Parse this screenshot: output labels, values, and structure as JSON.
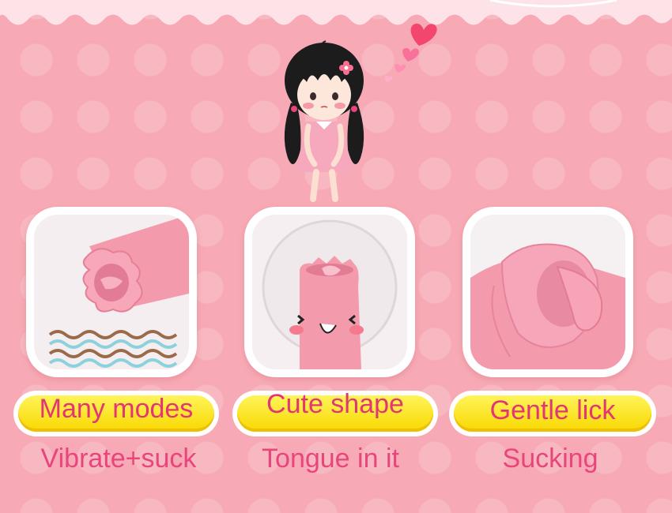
{
  "features": [
    {
      "label": "Many modes",
      "caption": "Vibrate+suck"
    },
    {
      "label": "Cute shape",
      "caption": "Tongue in it"
    },
    {
      "label": "Gentle lick",
      "caption": "Sucking"
    }
  ],
  "colors": {
    "background": "#f7aab5",
    "label_text": "#e23575",
    "caption_text": "#e8467b",
    "pill_yellow": "#fff45a",
    "product_pink": "#f49aad"
  },
  "icons": [
    "girl-illustration",
    "heart-icon",
    "wavy-lines-icon",
    "smiley-face-icon"
  ]
}
